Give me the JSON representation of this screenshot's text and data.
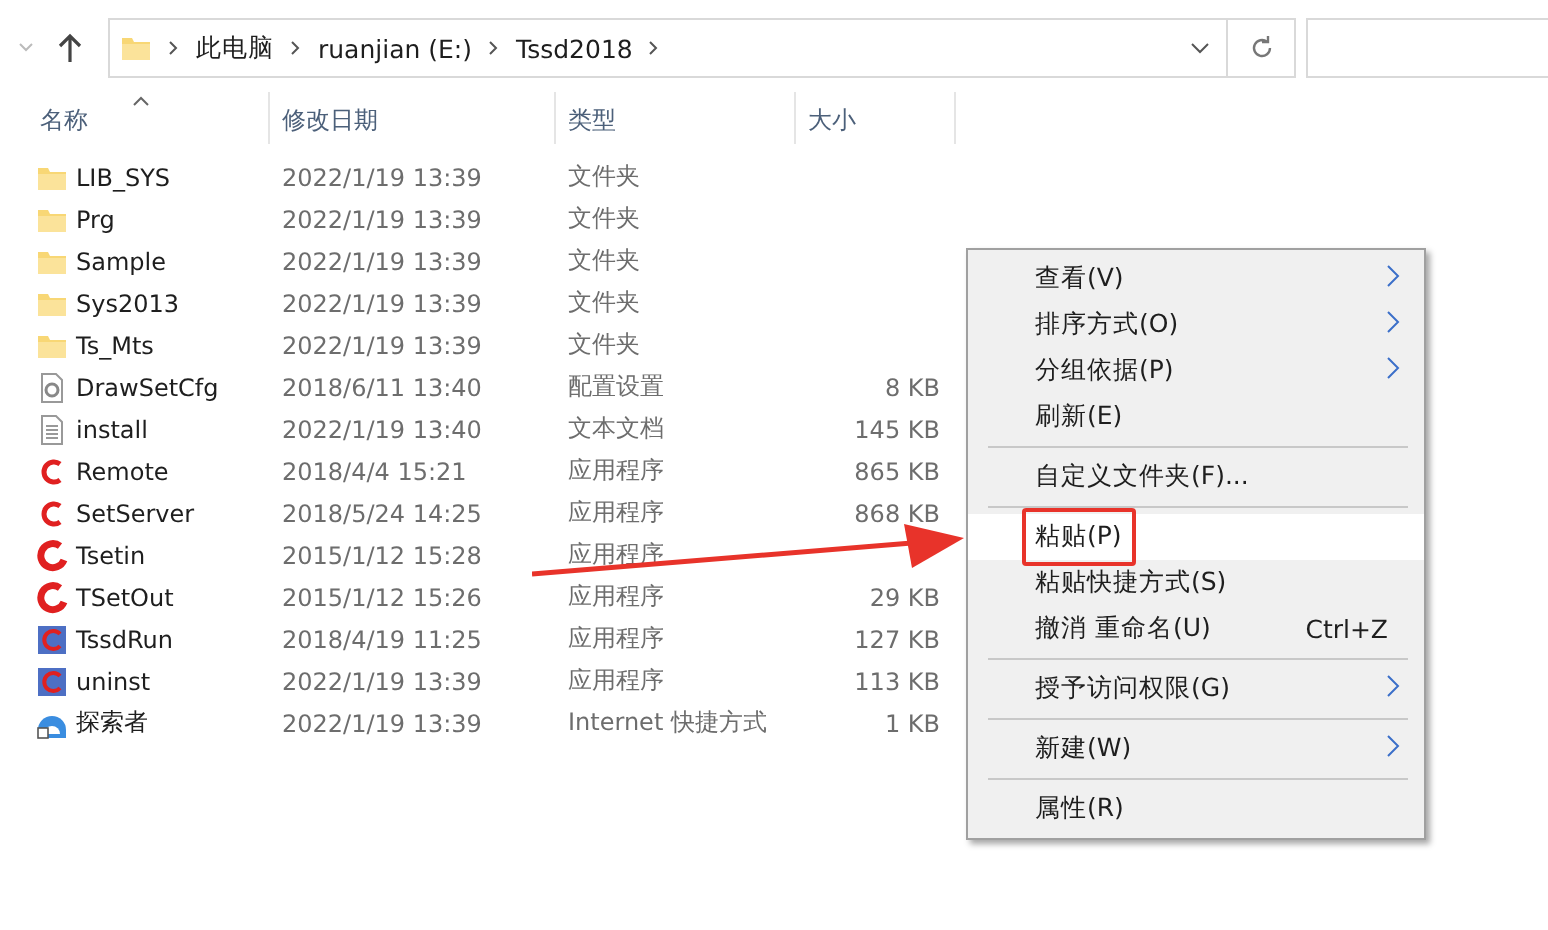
{
  "address_bar": {
    "crumbs": [
      "此电脑",
      "ruanjian (E:)",
      "Tssd2018"
    ]
  },
  "columns": [
    {
      "label": "名称",
      "sorted": true
    },
    {
      "label": "修改日期",
      "sorted": false
    },
    {
      "label": "类型",
      "sorted": false
    },
    {
      "label": "大小",
      "sorted": false
    }
  ],
  "files": [
    {
      "kind": "folder",
      "name": "LIB_SYS",
      "date": "2022/1/19 13:39",
      "type": "文件夹"
    },
    {
      "kind": "folder",
      "name": "Prg",
      "date": "2022/1/19 13:39",
      "type": "文件夹"
    },
    {
      "kind": "folder",
      "name": "Sample",
      "date": "2022/1/19 13:39",
      "type": "文件夹"
    },
    {
      "kind": "folder",
      "name": "Sys2013",
      "date": "2022/1/19 13:39",
      "type": "文件夹"
    },
    {
      "kind": "folder",
      "name": "Ts_Mts",
      "date": "2022/1/19 13:39",
      "type": "文件夹"
    },
    {
      "kind": "config",
      "name": "DrawSetCfg",
      "date": "2018/6/11 13:40",
      "type": "配置设置",
      "size": "8 KB"
    },
    {
      "kind": "text",
      "name": "install",
      "date": "2022/1/19 13:40",
      "type": "文本文档",
      "size": "145 KB"
    },
    {
      "kind": "remote",
      "name": "Remote",
      "date": "2018/4/4 15:21",
      "type": "应用程序",
      "size": "865 KB"
    },
    {
      "kind": "remote",
      "name": "SetServer",
      "date": "2018/5/24 14:25",
      "type": "应用程序",
      "size": "868 KB"
    },
    {
      "kind": "tset",
      "name": "Tsetin",
      "date": "2015/1/12 15:28",
      "type": "应用程序"
    },
    {
      "kind": "tset",
      "name": "TSetOut",
      "date": "2015/1/12 15:26",
      "type": "应用程序",
      "size": "29 KB"
    },
    {
      "kind": "tssd",
      "name": "TssdRun",
      "date": "2018/4/19 11:25",
      "type": "应用程序",
      "size": "127 KB"
    },
    {
      "kind": "tssd",
      "name": "uninst",
      "date": "2022/1/19 13:39",
      "type": "应用程序",
      "size": "113 KB"
    },
    {
      "kind": "shortcut",
      "name": "探索者",
      "date": "2022/1/19 13:39",
      "type": "Internet 快捷方式",
      "size": "1 KB"
    }
  ],
  "context_menu": {
    "groups": [
      [
        {
          "label": "查看(V)",
          "submenu": true,
          "selected": false
        },
        {
          "label": "排序方式(O)",
          "submenu": true,
          "selected": false
        },
        {
          "label": "分组依据(P)",
          "submenu": true,
          "selected": false
        },
        {
          "label": "刷新(E)",
          "submenu": false,
          "selected": false
        }
      ],
      [
        {
          "label": "自定义文件夹(F)...",
          "submenu": false,
          "selected": false
        }
      ],
      [
        {
          "label": "粘贴(P)",
          "submenu": false,
          "selected": true,
          "outlined": true
        },
        {
          "label": "粘贴快捷方式(S)",
          "submenu": false,
          "selected": false
        },
        {
          "label": "撤消 重命名(U)",
          "shortcut": "Ctrl+Z",
          "submenu": false,
          "selected": false
        }
      ],
      [
        {
          "label": "授予访问权限(G)",
          "submenu": true,
          "selected": false
        }
      ],
      [
        {
          "label": "新建(W)",
          "submenu": true,
          "selected": false
        }
      ],
      [
        {
          "label": "属性(R)",
          "submenu": false,
          "selected": false
        }
      ]
    ]
  }
}
